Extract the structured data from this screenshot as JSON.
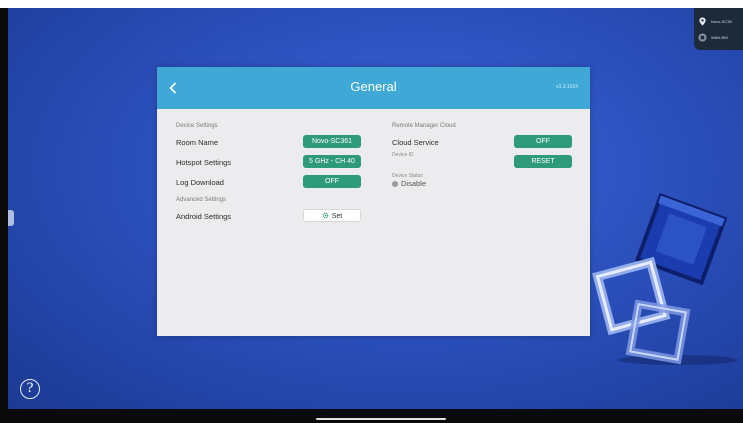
{
  "status_tray": {
    "location_text": "Novo-SC36",
    "network_text": "WAN-RM"
  },
  "panel": {
    "title": "General",
    "version": "v3.3.1624",
    "left": {
      "device_settings_label": "Device Settings",
      "room_name_label": "Room Name",
      "room_name_value": "Novo-SC361",
      "hotspot_label": "Hotspot Settings",
      "hotspot_value": "5 GHz - CH 40",
      "log_download_label": "Log Download",
      "log_download_value": "OFF",
      "advanced_settings_label": "Advanced Settings",
      "android_settings_label": "Android Settings",
      "android_settings_button": "Set"
    },
    "right": {
      "remote_manager_label": "Remote Manager Cloud",
      "cloud_service_label": "Cloud Service",
      "cloud_service_value": "OFF",
      "device_id_label": "Device ID",
      "device_id_button": "RESET",
      "device_status_label": "Device Status",
      "device_status_value": "Disable"
    }
  },
  "help_button": "?",
  "colors": {
    "accent_header": "#3fa8d7",
    "pill_green": "#2e9a7a",
    "desktop_blue": "#2f55c4"
  }
}
